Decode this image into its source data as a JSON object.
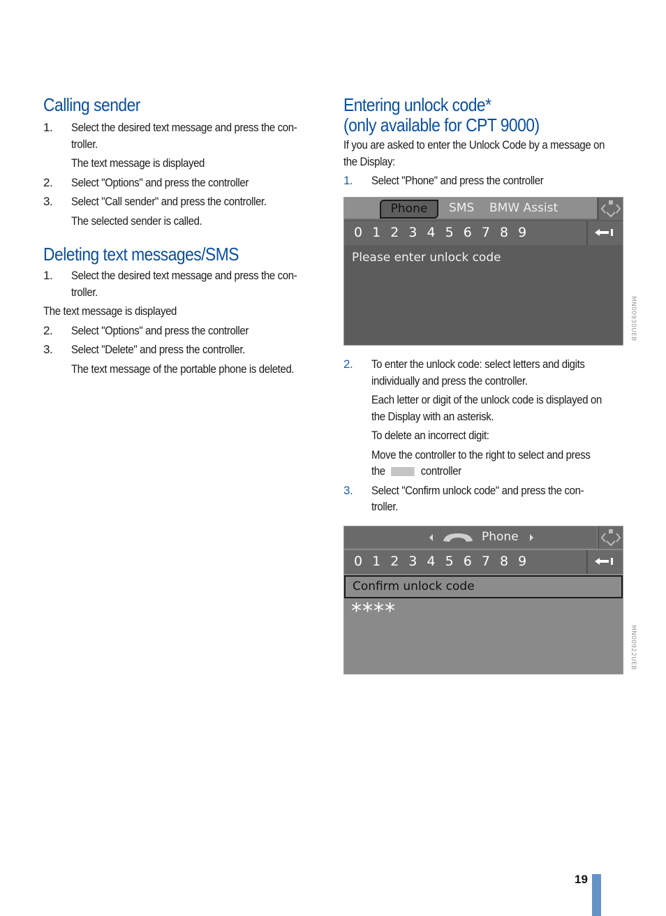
{
  "left_column": {
    "calling_sender": {
      "heading": "Calling sender",
      "steps": [
        {
          "num": "1.",
          "lines": [
            "Select the desired text message and press the con-",
            "troller."
          ],
          "notes": [
            "The text message is displayed"
          ]
        },
        {
          "num": "2.",
          "lines": [
            "Select \"Options\" and press the controller"
          ],
          "notes": []
        },
        {
          "num": "3.",
          "lines": [
            "Select \"Call sender\" and press the controller."
          ],
          "notes": [
            "The selected sender is called."
          ]
        }
      ]
    },
    "deleting_sms": {
      "heading": "Deleting text messages/SMS",
      "step1": {
        "num": "1.",
        "lines": [
          "Select the desired text message and press the con-",
          "troller."
        ]
      },
      "plain_note": "The text message is displayed",
      "step2": {
        "num": "2.",
        "text": "Select \"Options\" and press the controller"
      },
      "step3": {
        "num": "3.",
        "text": "Select \"Delete\" and press the controller."
      },
      "step3_note": "The text message of the portable phone is deleted."
    }
  },
  "right_column": {
    "heading_line1": "Entering unlock code*",
    "heading_line2": "(only available for CPT 9000)",
    "intro_line1": "If you are asked to enter the Unlock Code by a message on",
    "intro_line2": "the Display:",
    "step1": {
      "num": "1.",
      "text": "Select \"Phone\" and press the controller"
    },
    "step2": {
      "num": "2.",
      "lines": [
        "To enter the unlock code: select letters and digits",
        "individually and press the controller."
      ],
      "note1_lines": [
        "Each letter or digit of the unlock code is displayed on",
        "the Display with an asterisk."
      ],
      "note2": "To delete an incorrect digit:",
      "note3_line1": "Move the controller to the right to select and press",
      "note3_before": "the",
      "note3_after": "controller"
    },
    "step3": {
      "num": "3.",
      "lines": [
        "Select \"Confirm unlock code\" and press the con-",
        "troller."
      ]
    }
  },
  "display1": {
    "tabs": [
      "Phone",
      "SMS",
      "BMW Assist"
    ],
    "active_tab": "Phone",
    "digits": "0 1 2 3 4 5 6 7 8 9",
    "message": "Please enter unlock code",
    "image_code": "MN00930UEB",
    "icons": {
      "nav": "controller-nav-icon",
      "back": "backspace-arrow-icon"
    }
  },
  "display2": {
    "title": "Phone",
    "digits": "0 1 2 3 4 5 6 7 8 9",
    "selected_item": "Confirm unlock code",
    "entered_code": "****",
    "image_code": "MN00922UEB",
    "icons": {
      "handset": "phone-handset-icon",
      "nav": "controller-nav-icon",
      "back": "backspace-arrow-icon"
    }
  },
  "footer": {
    "page_number": "19",
    "accent_color": "#6592c9"
  },
  "colors": {
    "heading": "#0a4f9c",
    "step_number_right": "#1f5ea8"
  }
}
